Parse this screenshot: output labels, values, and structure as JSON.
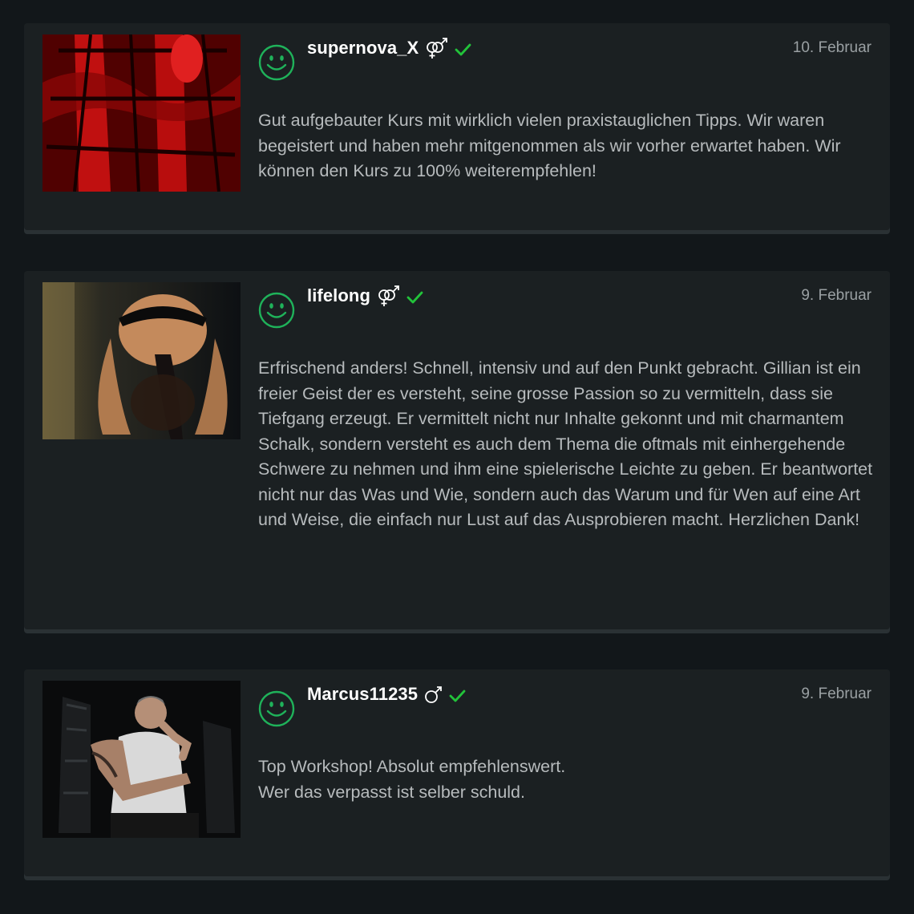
{
  "reviews": [
    {
      "username": "supernova_X",
      "gender": "couple-icon",
      "verified": true,
      "date": "10. Februar",
      "text": "Gut aufgebauter Kurs mit wirklich vielen praxistauglichen Tipps. Wir waren begeistert und haben mehr mitgenommen als wir vorher erwartet haben. Wir können den Kurs zu 100% weiterempfehlen!",
      "photo": "red-lit-legs-photo"
    },
    {
      "username": "lifelong",
      "gender": "couple-icon",
      "verified": true,
      "date": "9. Februar",
      "text": "Erfrischend anders! Schnell, intensiv und auf den Punkt gebracht. Gillian ist ein freier Geist der es versteht, seine grosse Passion so zu vermitteln, dass sie Tiefgang erzeugt. Er vermittelt nicht nur Inhalte gekonnt und mit charmantem Schalk, sondern versteht es auch dem Thema die oftmals mit einhergehende Schwere zu nehmen und ihm eine spielerische Leichte zu geben. Er beantwortet nicht nur das Was und Wie, sondern auch das Warum und für Wen auf eine Art und Weise, die einfach nur Lust auf das Ausprobieren macht. Herzlichen Dank!",
      "photo": "kneeling-figure-photo"
    },
    {
      "username": "Marcus11235",
      "gender": "male-icon",
      "verified": true,
      "date": "9. Februar",
      "text": "Top Workshop! Absolut empfehlenswert.\nWer das verpasst ist selber schuld.",
      "photo": "seated-man-photo"
    }
  ],
  "colors": {
    "background": "#12171a",
    "card": "#1b2022",
    "accent_green": "#1fb25a",
    "check_green": "#22c33a",
    "username": "#ffffff",
    "body_text": "#b7bbbd",
    "date": "#9aa0a3"
  }
}
